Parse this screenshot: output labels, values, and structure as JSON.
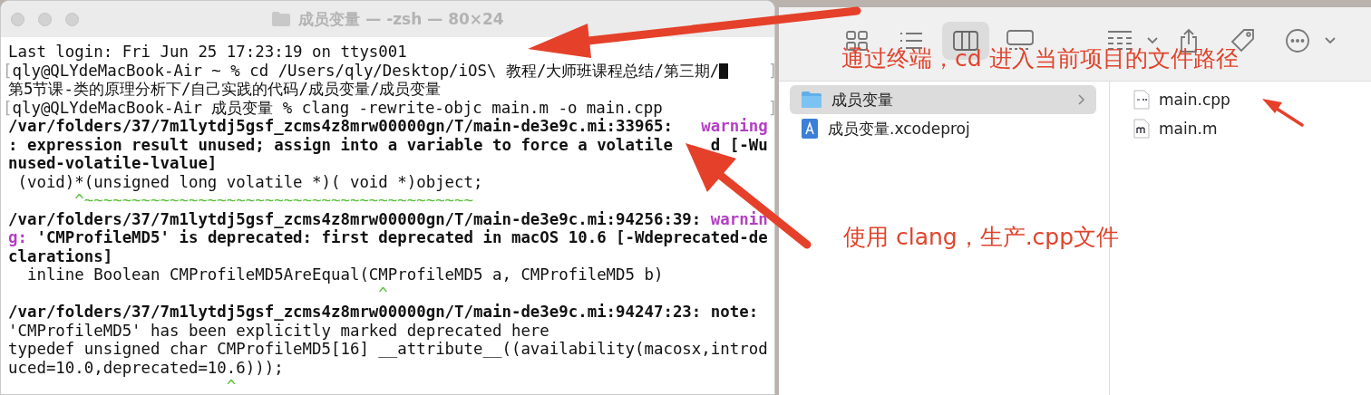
{
  "terminal": {
    "title": "成员变量 — -zsh — 80×24",
    "lines": [
      {
        "segments": [
          {
            "kind": "plain",
            "text": "Last login: Fri Jun 25 17:23:19 on ttys001"
          }
        ]
      },
      {
        "segments": [
          {
            "kind": "mark",
            "text": "["
          },
          {
            "kind": "plain",
            "text": "qly@QLYdeMacBook-Air ~ % cd /Users/qly/Desktop/iOS\\ 教程/大师班课程总结/第三期/"
          },
          {
            "kind": "cursor"
          }
        ],
        "right_mark": "]"
      },
      {
        "segments": [
          {
            "kind": "plain",
            "text": "第5节课-类的原理分析下/自己实践的代码/成员变量/成员变量"
          }
        ]
      },
      {
        "segments": [
          {
            "kind": "mark",
            "text": "["
          },
          {
            "kind": "plain",
            "text": "qly@QLYdeMacBook-Air 成员变量 % clang -rewrite-objc main.m -o main.cpp"
          }
        ],
        "right_mark": "]"
      },
      {
        "segments": [
          {
            "kind": "bold",
            "text": "/var/folders/37/7m1lytdj5gsf_zcms4z8mrw00000gn/T/main-de3e9c.mi:33965:   "
          },
          {
            "kind": "warning",
            "text": "warning"
          }
        ]
      },
      {
        "segments": [
          {
            "kind": "bold",
            "text": ": expression result unused; assign into a variable to force a volatile"
          },
          {
            "kind": "bold",
            "text": "d [-Wu",
            "gap_before": true
          }
        ]
      },
      {
        "segments": [
          {
            "kind": "bold",
            "text": "nused-volatile-lvalue]"
          }
        ]
      },
      {
        "segments": [
          {
            "kind": "plain",
            "text": " (void)*(unsigned long volatile *)( void *)object;"
          }
        ]
      },
      {
        "segments": [
          {
            "kind": "caret",
            "text": "       ^~~~~~~~~~~~~~~~~~~~~~~~~~~~~~~~~~~~~~~~~~"
          }
        ]
      },
      {
        "segments": [
          {
            "kind": "bold",
            "text": "/var/folders/37/7m1lytdj5gsf_zcms4z8mrw00000gn/T/main-de3e9c.mi:94256:39: "
          },
          {
            "kind": "warning",
            "text": "warnin"
          }
        ]
      },
      {
        "segments": [
          {
            "kind": "warning",
            "text": "g:"
          },
          {
            "kind": "bold",
            "text": " 'CMProfileMD5' is deprecated: first deprecated in macOS 10.6 [-Wdeprecated-de"
          }
        ]
      },
      {
        "segments": [
          {
            "kind": "bold",
            "text": "clarations]"
          }
        ]
      },
      {
        "segments": [
          {
            "kind": "plain",
            "text": "  inline Boolean CMProfileMD5AreEqual(CMProfileMD5 a, CMProfileMD5 b)"
          }
        ]
      },
      {
        "segments": [
          {
            "kind": "caret",
            "text": "                                       ^"
          }
        ]
      },
      {
        "segments": [
          {
            "kind": "bold",
            "text": "/var/folders/37/7m1lytdj5gsf_zcms4z8mrw00000gn/T/main-de3e9c.mi:94247:23: note:"
          }
        ]
      },
      {
        "segments": [
          {
            "kind": "plain",
            "text": "'CMProfileMD5' has been explicitly marked deprecated here"
          }
        ]
      },
      {
        "segments": [
          {
            "kind": "plain",
            "text": "typedef unsigned char CMProfileMD5[16] __attribute__((availability(macosx,introd"
          }
        ]
      },
      {
        "segments": [
          {
            "kind": "plain",
            "text": "uced=10.0,deprecated=10.6)));"
          }
        ]
      },
      {
        "segments": [
          {
            "kind": "caret",
            "text": "                       ^"
          }
        ]
      }
    ]
  },
  "finder": {
    "toolbar": [
      {
        "kind": "grid",
        "selected": false
      },
      {
        "kind": "list",
        "selected": false
      },
      {
        "kind": "columns",
        "selected": true
      },
      {
        "kind": "gallery",
        "selected": false
      },
      {
        "kind": "group",
        "selected": false
      },
      {
        "kind": "share",
        "selected": false
      },
      {
        "kind": "tag",
        "selected": false
      },
      {
        "kind": "more",
        "selected": false
      }
    ],
    "columns": [
      [
        {
          "name": "成员变量",
          "kind": "folder",
          "selected": true
        },
        {
          "name": "成员变量.xcodeproj",
          "kind": "xcodeproj",
          "selected": false
        }
      ],
      [
        {
          "name": "main.cpp",
          "kind": "cpp",
          "selected": false
        },
        {
          "name": "main.m",
          "kind": "m",
          "selected": false
        }
      ]
    ]
  },
  "annotations": [
    {
      "text": "通过终端，cd 进入当前项目的文件路径"
    },
    {
      "text": "使用 clang，生产.cpp文件"
    }
  ]
}
